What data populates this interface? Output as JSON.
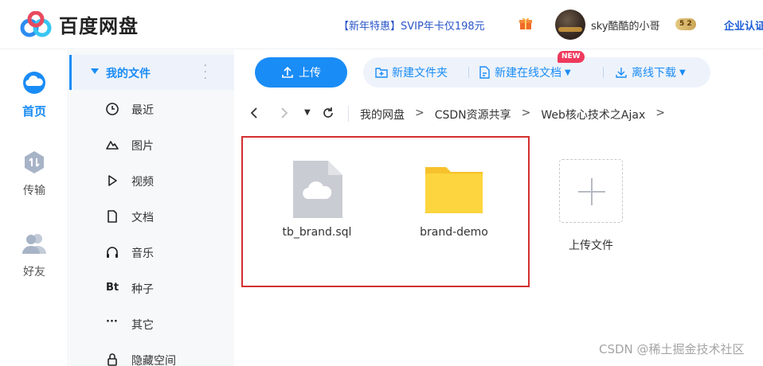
{
  "header": {
    "logo_text": "百度网盘",
    "promo": "【新年特惠】SVIP年卡仅198元",
    "username": "sky酷酷的小哥",
    "vip_level": "5 2",
    "enterprise": "企业认证"
  },
  "rail": [
    {
      "label": "首页",
      "icon": "cloud-home-icon"
    },
    {
      "label": "传输",
      "icon": "transfer-icon"
    },
    {
      "label": "好友",
      "icon": "friends-icon"
    }
  ],
  "sidebar": {
    "header": "我的文件",
    "items": [
      {
        "label": "最近",
        "icon": "clock-icon"
      },
      {
        "label": "图片",
        "icon": "mountain-icon"
      },
      {
        "label": "视频",
        "icon": "play-icon"
      },
      {
        "label": "文档",
        "icon": "document-icon"
      },
      {
        "label": "音乐",
        "icon": "headphones-icon"
      },
      {
        "label": "种子",
        "icon": "bt-icon",
        "glyph": "Bt"
      },
      {
        "label": "其它",
        "icon": "more-icon",
        "glyph": "···"
      },
      {
        "label": "隐藏空间",
        "icon": "lock-icon"
      }
    ]
  },
  "toolbar": {
    "upload": "上传",
    "new_folder": "新建文件夹",
    "new_online_doc": "新建在线文档",
    "offline_download": "离线下载",
    "new_badge": "NEW"
  },
  "breadcrumb": {
    "items": [
      "我的网盘",
      "CSDN资源共享",
      "Web核心技术之Ajax"
    ],
    "separator": ">"
  },
  "files": [
    {
      "name": "tb_brand.sql",
      "type": "file",
      "icon": "cloud-file-icon"
    },
    {
      "name": "brand-demo",
      "type": "folder",
      "icon": "folder-icon"
    }
  ],
  "upload_tile": {
    "label": "上传文件"
  },
  "watermark": "CSDN @稀土掘金技术社区",
  "colors": {
    "accent": "#1a8cf5",
    "highlight": "#d32f2f",
    "folder": "#fdd53e"
  }
}
